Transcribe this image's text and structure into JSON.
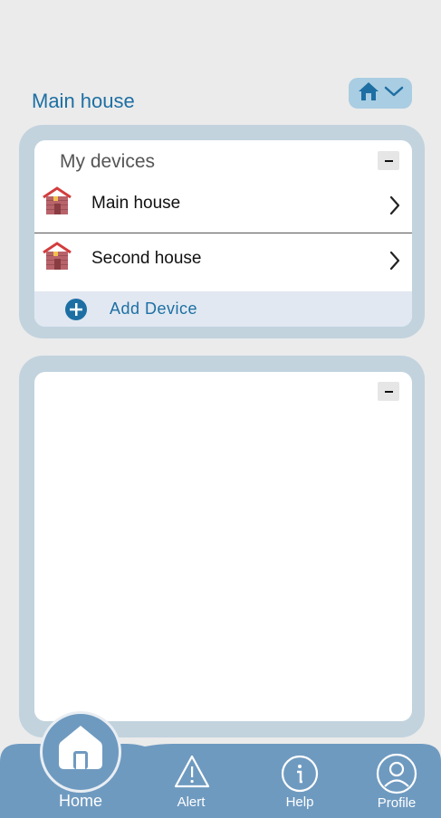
{
  "header": {
    "title": "Main house",
    "switcher_icon": "house-icon",
    "switcher_chevron": "chevron-down-icon"
  },
  "devices_card": {
    "title": "My devices",
    "items": [
      {
        "label": "Main house",
        "icon": "house-icon"
      },
      {
        "label": "Second house",
        "icon": "house-icon"
      }
    ],
    "add_label": "Add Device"
  },
  "bottom_nav": {
    "items": [
      {
        "label": "Home",
        "icon": "home-icon",
        "active": true
      },
      {
        "label": "Alert",
        "icon": "alert-icon"
      },
      {
        "label": "Help",
        "icon": "info-icon"
      },
      {
        "label": "Profile",
        "icon": "profile-icon"
      }
    ]
  },
  "colors": {
    "accent": "#1d6fa3",
    "nav_background": "#6f9ac0",
    "card_border": "#c2d3de",
    "background": "#ebebeb"
  }
}
